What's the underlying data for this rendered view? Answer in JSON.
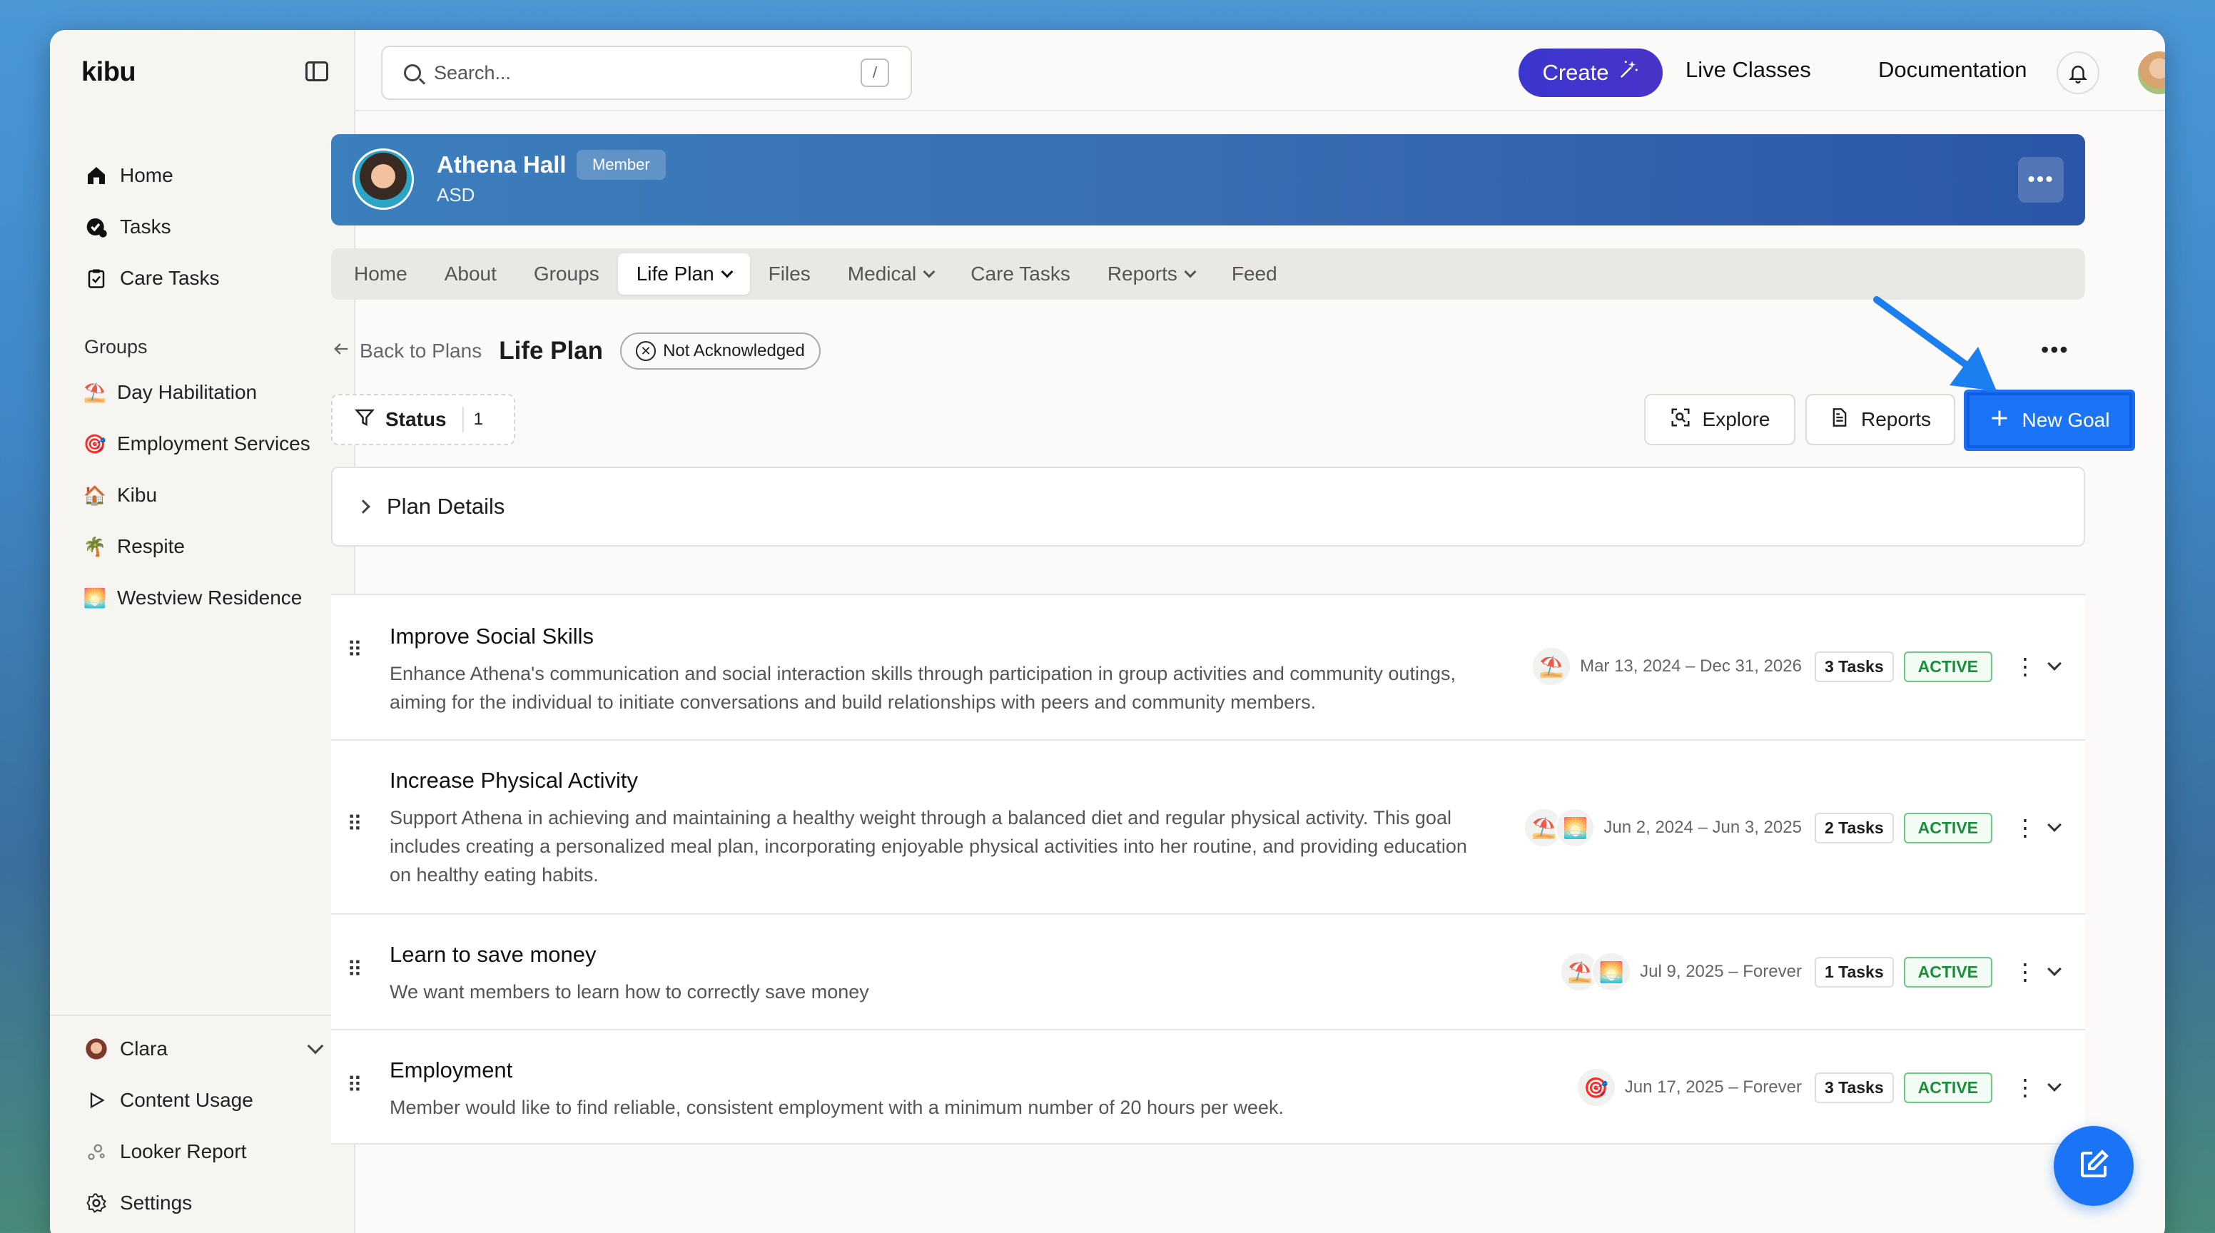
{
  "app": {
    "logo": "kibu"
  },
  "sidebar": {
    "main_items": [
      {
        "label": "Home",
        "icon": "home-icon"
      },
      {
        "label": "Tasks",
        "icon": "tasks-icon"
      },
      {
        "label": "Care Tasks",
        "icon": "clipboard-icon"
      }
    ],
    "groups_heading": "Groups",
    "groups": [
      {
        "label": "Day Habilitation",
        "emoji": "⛱️"
      },
      {
        "label": "Employment Services",
        "emoji": "🎯"
      },
      {
        "label": "Kibu",
        "emoji": "🏠"
      },
      {
        "label": "Respite",
        "emoji": "🌴"
      },
      {
        "label": "Westview Residence",
        "emoji": "🌅"
      }
    ],
    "bottom_items": [
      {
        "label": "Clara",
        "icon": "user-avatar"
      },
      {
        "label": "Content Usage",
        "icon": "play-icon"
      },
      {
        "label": "Looker Report",
        "icon": "chart-icon"
      },
      {
        "label": "Settings",
        "icon": "gear-icon"
      }
    ]
  },
  "topbar": {
    "search_placeholder": "Search...",
    "search_shortcut": "/",
    "create_label": "Create",
    "links": [
      "Live Classes",
      "Documentation"
    ]
  },
  "profile": {
    "name": "Athena Hall",
    "role_badge": "Member",
    "subtitle": "ASD"
  },
  "tabs": [
    {
      "label": "Home",
      "dropdown": false
    },
    {
      "label": "About",
      "dropdown": false
    },
    {
      "label": "Groups",
      "dropdown": false
    },
    {
      "label": "Life Plan",
      "dropdown": true,
      "active": true
    },
    {
      "label": "Files",
      "dropdown": false
    },
    {
      "label": "Medical",
      "dropdown": true
    },
    {
      "label": "Care Tasks",
      "dropdown": false
    },
    {
      "label": "Reports",
      "dropdown": true
    },
    {
      "label": "Feed",
      "dropdown": false
    }
  ],
  "plan": {
    "back_label": "Back to Plans",
    "title": "Life Plan",
    "ack_status": "Not Acknowledged",
    "filter_label": "Status",
    "filter_count": "1",
    "explore_label": "Explore",
    "reports_label": "Reports",
    "new_goal_label": "New Goal",
    "details_label": "Plan Details"
  },
  "goals": [
    {
      "title": "Improve Social Skills",
      "description": "Enhance Athena's communication and social interaction skills through participation in group activities and community outings, aiming for the individual to initiate conversations and build relationships with peers and community members.",
      "groups": [
        "⛱️"
      ],
      "dates": "Mar 13, 2024 – Dec 31, 2026",
      "tasks": "3 Tasks",
      "status": "ACTIVE"
    },
    {
      "title": "Increase Physical Activity",
      "description": "Support Athena in achieving and maintaining a healthy weight through a balanced diet and regular physical activity. This goal includes creating a personalized meal plan, incorporating enjoyable physical activities into her routine, and providing education on healthy eating habits.",
      "groups": [
        "⛱️",
        "🌅"
      ],
      "dates": "Jun 2, 2024 – Jun 3, 2025",
      "tasks": "2 Tasks",
      "status": "ACTIVE"
    },
    {
      "title": "Learn to save money",
      "description": "We want members to learn how to correctly save money",
      "groups": [
        "⛱️",
        "🌅"
      ],
      "dates": "Jul 9, 2025 – Forever",
      "tasks": "1 Tasks",
      "status": "ACTIVE"
    },
    {
      "title": "Employment",
      "description": "Member would like to find reliable, consistent employment with a minimum number of 20 hours per week.",
      "groups": [
        "🎯"
      ],
      "dates": "Jun 17, 2025 – Forever",
      "tasks": "3 Tasks",
      "status": "ACTIVE"
    }
  ],
  "colors": {
    "accent": "#1a74f5",
    "create_button": "#3a37d0",
    "banner_start": "#3c7fbd",
    "banner_end": "#2b56a7",
    "active_status": "#1a8e3a"
  }
}
